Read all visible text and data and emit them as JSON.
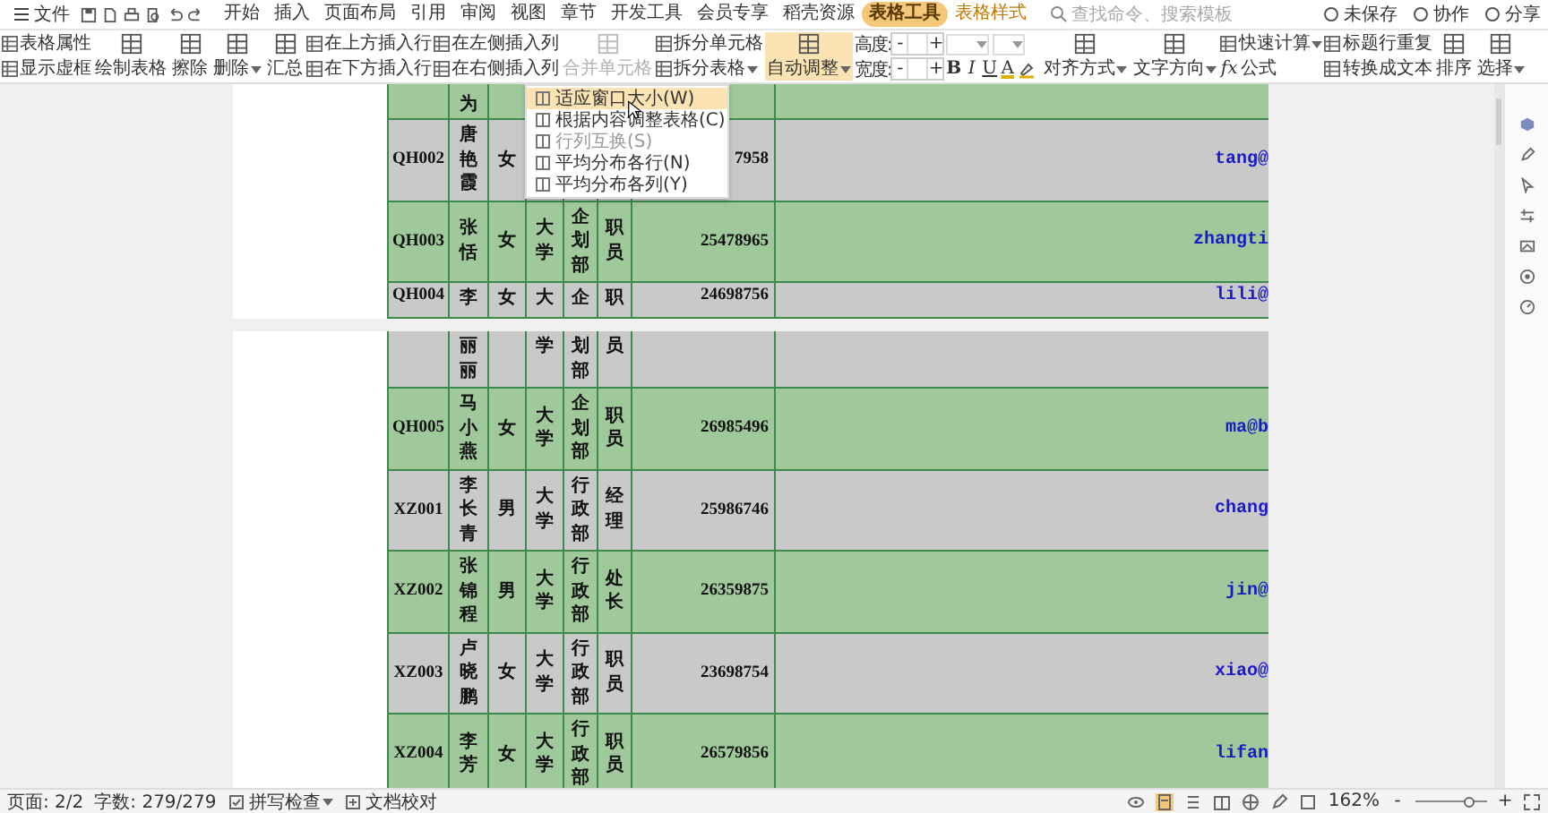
{
  "menu_bar": {
    "file": "文件",
    "tabs": [
      {
        "label": "开始",
        "selected": false,
        "contextual": false
      },
      {
        "label": "插入",
        "selected": false,
        "contextual": false
      },
      {
        "label": "页面布局",
        "selected": false,
        "contextual": false
      },
      {
        "label": "引用",
        "selected": false,
        "contextual": false
      },
      {
        "label": "审阅",
        "selected": false,
        "contextual": false
      },
      {
        "label": "视图",
        "selected": false,
        "contextual": false
      },
      {
        "label": "章节",
        "selected": false,
        "contextual": false
      },
      {
        "label": "开发工具",
        "selected": false,
        "contextual": false
      },
      {
        "label": "会员专享",
        "selected": false,
        "contextual": false
      },
      {
        "label": "稻壳资源",
        "selected": false,
        "contextual": false
      },
      {
        "label": "表格工具",
        "selected": true,
        "contextual": true
      },
      {
        "label": "表格样式",
        "selected": false,
        "contextual": true
      }
    ],
    "search": {
      "placeholder": "查找命令、搜索模板"
    },
    "actions": [
      "未保存",
      "协作",
      "分享"
    ]
  },
  "ribbon": [
    {
      "kind": "stack",
      "items": [
        {
          "label": "表格属性",
          "dropdown": false,
          "disabled": false
        },
        {
          "label": "显示虚框",
          "dropdown": false,
          "disabled": false
        }
      ]
    },
    {
      "kind": "large",
      "label": "绘制表格",
      "dropdown": false,
      "disabled": false,
      "active": false
    },
    {
      "kind": "large",
      "label": "擦除",
      "dropdown": false,
      "disabled": false,
      "active": false
    },
    {
      "kind": "large",
      "label": "删除",
      "dropdown": true,
      "disabled": false,
      "active": false
    },
    {
      "kind": "large",
      "label": "汇总",
      "dropdown": false,
      "disabled": false,
      "active": false
    },
    {
      "kind": "stack",
      "items": [
        {
          "label": "在上方插入行",
          "dropdown": false,
          "disabled": false
        },
        {
          "label": "在下方插入行",
          "dropdown": false,
          "disabled": false
        }
      ]
    },
    {
      "kind": "stack",
      "items": [
        {
          "label": "在左侧插入列",
          "dropdown": false,
          "disabled": false
        },
        {
          "label": "在右侧插入列",
          "dropdown": false,
          "disabled": false
        }
      ]
    },
    {
      "kind": "large",
      "label": "合并单元格",
      "dropdown": false,
      "disabled": true,
      "active": false
    },
    {
      "kind": "stack",
      "items": [
        {
          "label": "拆分单元格",
          "dropdown": false,
          "disabled": false
        },
        {
          "label": "拆分表格",
          "dropdown": true,
          "disabled": false
        }
      ]
    },
    {
      "kind": "large",
      "label": "自动调整",
      "dropdown": true,
      "disabled": false,
      "active": true
    },
    {
      "kind": "spinners",
      "items": [
        {
          "label": "高度:",
          "decrement": "-",
          "increment": "+"
        },
        {
          "label": "宽度:",
          "decrement": "-",
          "increment": "+"
        }
      ]
    },
    {
      "kind": "font",
      "buttons": [
        "B",
        "I",
        "U",
        "A"
      ]
    },
    {
      "kind": "large",
      "label": "对齐方式",
      "dropdown": true,
      "disabled": false,
      "active": false
    },
    {
      "kind": "large",
      "label": "文字方向",
      "dropdown": true,
      "disabled": false,
      "active": false
    },
    {
      "kind": "stack",
      "items": [
        {
          "label": "快速计算",
          "dropdown": true,
          "disabled": false
        },
        {
          "label": "公式",
          "glyph": "fx",
          "dropdown": false,
          "disabled": false
        }
      ]
    },
    {
      "kind": "stack",
      "items": [
        {
          "label": "标题行重复",
          "dropdown": false,
          "disabled": false
        },
        {
          "label": "转换成文本",
          "dropdown": false,
          "disabled": false
        }
      ]
    },
    {
      "kind": "large",
      "label": "排序",
      "dropdown": false,
      "disabled": false,
      "active": false
    },
    {
      "kind": "large",
      "label": "选择",
      "dropdown": true,
      "disabled": false,
      "active": false
    }
  ],
  "document": {
    "pages": [
      {
        "rows": [
          {
            "kind": "top_cut",
            "color": "#9fc99b",
            "column_2": "为"
          },
          {
            "kind": "full",
            "color": "#c9c9c9",
            "column_1": "QH002",
            "column_2": "唐艳霞",
            "column_3": "女",
            "column_7": "7958",
            "column_8": "tang@"
          },
          {
            "kind": "full",
            "color": "#9fc99b",
            "column_1": "QH003",
            "column_2": "张恬",
            "column_3": "女",
            "column_4": "大学",
            "column_5": "企划部",
            "column_6": "职员",
            "column_7": "25478965",
            "column_8": "zhangti"
          },
          {
            "kind": "bottom_cut",
            "color": "#c9c9c9",
            "column_1": "QH004",
            "column_2": "李",
            "column_3": "女",
            "column_4": "大",
            "column_5": "企",
            "column_6": "职",
            "column_7": "24698756",
            "column_8": "lili@"
          }
        ]
      },
      {
        "rows": [
          {
            "kind": "continued",
            "color": "#c9c9c9",
            "column_2": "丽丽",
            "column_4": "学",
            "column_5": "划部",
            "column_6": "员"
          },
          {
            "kind": "full",
            "color": "#9fc99b",
            "column_1": "QH005",
            "column_2": "马小燕",
            "column_3": "女",
            "column_4": "大学",
            "column_5": "企划部",
            "column_6": "职员",
            "column_7": "26985496",
            "column_8": "ma@b"
          },
          {
            "kind": "full",
            "color": "#c9c9c9",
            "column_1": "XZ001",
            "column_2": "李长青",
            "column_3": "男",
            "column_4": "大学",
            "column_5": "行政部",
            "column_6": "经理",
            "column_7": "25986746",
            "column_8": "chang"
          },
          {
            "kind": "full",
            "color": "#9fc99b",
            "column_1": "XZ002",
            "column_2": "张锦程",
            "column_3": "男",
            "column_4": "大学",
            "column_5": "行政部",
            "column_6": "处长",
            "column_7": "26359875",
            "column_8": "jin@"
          },
          {
            "kind": "full",
            "color": "#c9c9c9",
            "column_1": "XZ003",
            "column_2": "卢晓鹏",
            "column_3": "女",
            "column_4": "大学",
            "column_5": "行政部",
            "column_6": "职员",
            "column_7": "23698754",
            "column_8": "xiao@"
          },
          {
            "kind": "full",
            "color": "#9fc99b",
            "column_1": "XZ004",
            "column_2": "李芳",
            "column_3": "女",
            "column_4": "大学",
            "column_5": "行政部",
            "column_6": "职员",
            "column_7": "26579856",
            "column_8": "lifan"
          }
        ]
      }
    ]
  },
  "dropdown_menu": {
    "items": [
      {
        "label": "适应窗口大小(W)",
        "selected": true,
        "disabled": false
      },
      {
        "label": "根据内容调整表格(C)",
        "selected": false,
        "disabled": false
      },
      {
        "label": "行列互换(S)",
        "selected": false,
        "disabled": true
      },
      {
        "label": "平均分布各行(N)",
        "selected": false,
        "disabled": false
      },
      {
        "label": "平均分布各列(Y)",
        "selected": false,
        "disabled": false
      }
    ]
  },
  "status_bar": {
    "page": "页面: 2/2",
    "words": "字数: 279/279",
    "spell_check": "拼写检查",
    "proofread": "文档校对",
    "zoom": "162%",
    "zoom_slider": {
      "level": 0.75
    },
    "decrement": "-",
    "increment": "+"
  }
}
